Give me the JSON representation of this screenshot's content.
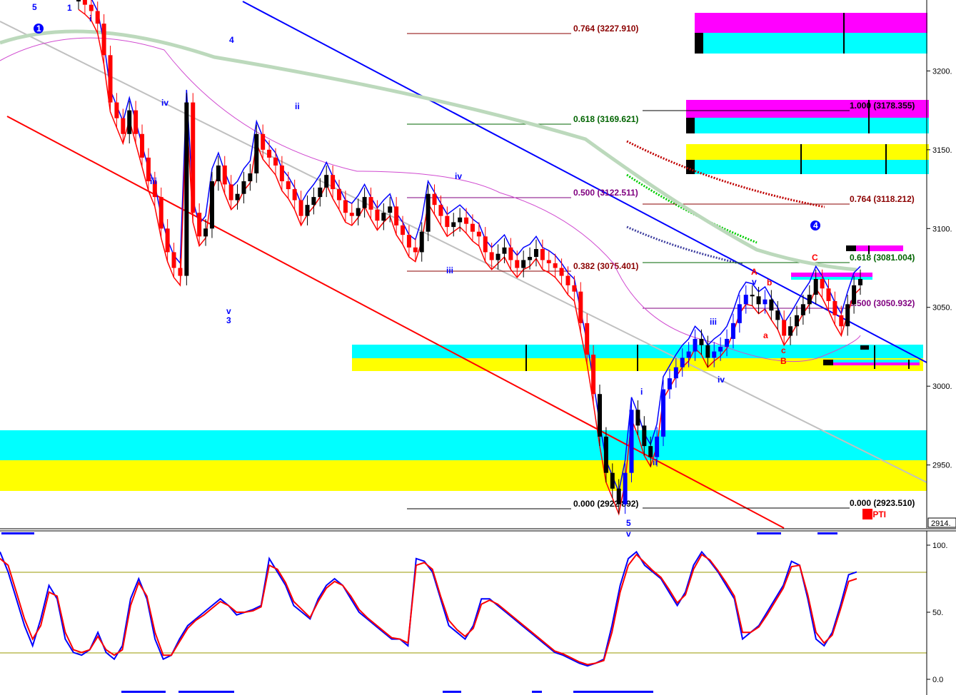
{
  "colors": {
    "cyan": "#00ffff",
    "yellow": "#ffff00",
    "magenta": "#ff00ff",
    "red": "#ff0000",
    "blue": "#0000ff",
    "black": "#000000",
    "dark_red": "#8b0000",
    "green": "#006400",
    "purple": "#800080",
    "pale_green": "#bcd9bc",
    "olive": "#999900"
  },
  "chart_data": [
    {
      "type": "candlestick",
      "title": "",
      "y_axis_ticks": [
        "3200.",
        "3150.",
        "3100.",
        "3050.",
        "3000.",
        "2950."
      ],
      "last_price_label": "2914.",
      "ylim": [
        2910,
        3245
      ],
      "grid": false,
      "price_path": [
        3245,
        3242,
        3238,
        3230,
        3210,
        3180,
        3170,
        3160,
        3175,
        3160,
        3145,
        3130,
        3120,
        3100,
        3085,
        3075,
        3070,
        3180,
        3110,
        3095,
        3100,
        3130,
        3140,
        3128,
        3118,
        3122,
        3130,
        3135,
        3160,
        3150,
        3145,
        3140,
        3130,
        3125,
        3118,
        3108,
        3115,
        3120,
        3126,
        3134,
        3125,
        3118,
        3110,
        3108,
        3113,
        3120,
        3112,
        3105,
        3110,
        3114,
        3102,
        3096,
        3088,
        3085,
        3098,
        3122,
        3115,
        3108,
        3101,
        3104,
        3107,
        3103,
        3098,
        3095,
        3085,
        3080,
        3084,
        3088,
        3080,
        3075,
        3080,
        3082,
        3087,
        3080,
        3078,
        3075,
        3070,
        3064,
        3060,
        3040,
        3020,
        2995,
        2968,
        2945,
        2935,
        2925,
        2945,
        2985,
        2975,
        2962,
        2955,
        2968,
        2998,
        3005,
        3012,
        3018,
        3022,
        3030,
        3026,
        3018,
        3022,
        3025,
        3030,
        3040,
        3052,
        3058,
        3057,
        3052,
        3055,
        3048,
        3042,
        3032,
        3038,
        3045,
        3052,
        3058,
        3068,
        3062,
        3054,
        3045,
        3038,
        3052,
        3064,
        3068
      ],
      "annotations": {
        "wave_labels": [
          "5",
          "1",
          "i",
          "1",
          "iv",
          "iii",
          "v",
          "3",
          "4",
          "ii",
          "iii",
          "iv",
          "v",
          "5",
          "i",
          "ii",
          "iii",
          "iv",
          "A",
          "v",
          "b",
          "a",
          "c",
          "B",
          "C",
          "4"
        ],
        "fib_labels": [
          "0.764 (3227.910)",
          "0.618 (3169.621)",
          "0.500 (3122.511)",
          "0.382 (3075.401)",
          "0.000 (2922.892)",
          "1.000 (3178.355)",
          "0.764 (3118.212)",
          "0.618 (3081.004)",
          "0.500 (3050.932)",
          "0.000 (2923.510)"
        ],
        "indicator_tag": "47PTI"
      },
      "series": [
        {
          "color": "red"
        },
        {
          "color": "blue"
        },
        {
          "color": "purple"
        },
        {
          "color": "pale_green"
        }
      ]
    },
    {
      "type": "line",
      "title": "",
      "y_axis_ticks": [
        "100.",
        "50.",
        "0.0"
      ],
      "ylim": [
        0,
        100
      ],
      "grid": false,
      "series": [
        {
          "color": "blue",
          "values": [
            95,
            80,
            60,
            40,
            25,
            45,
            70,
            60,
            30,
            20,
            18,
            22,
            35,
            20,
            15,
            25,
            60,
            75,
            60,
            30,
            15,
            18,
            30,
            40,
            45,
            50,
            55,
            60,
            55,
            48,
            50,
            52,
            55,
            90,
            80,
            70,
            55,
            50,
            45,
            60,
            70,
            75,
            70,
            60,
            50,
            45,
            40,
            35,
            30,
            30,
            25,
            90,
            88,
            80,
            60,
            40,
            35,
            30,
            40,
            60,
            60,
            55,
            50,
            45,
            40,
            35,
            30,
            25,
            20,
            18,
            15,
            12,
            10,
            12,
            15,
            40,
            70,
            90,
            95,
            85,
            80,
            75,
            65,
            55,
            65,
            85,
            95,
            88,
            80,
            70,
            60,
            30,
            35,
            40,
            50,
            60,
            70,
            88,
            85,
            60,
            30,
            25,
            35,
            55,
            78,
            80
          ]
        },
        {
          "color": "red",
          "values": [
            90,
            85,
            65,
            45,
            30,
            40,
            65,
            62,
            35,
            22,
            20,
            22,
            32,
            22,
            18,
            22,
            55,
            72,
            62,
            35,
            18,
            18,
            28,
            38,
            44,
            48,
            53,
            58,
            55,
            50,
            50,
            51,
            54,
            85,
            82,
            72,
            58,
            52,
            46,
            58,
            68,
            73,
            70,
            62,
            52,
            46,
            41,
            36,
            31,
            30,
            27,
            85,
            87,
            82,
            62,
            44,
            37,
            32,
            38,
            56,
            59,
            56,
            51,
            46,
            41,
            36,
            31,
            26,
            21,
            19,
            16,
            13,
            11,
            12,
            14,
            35,
            65,
            85,
            93,
            87,
            81,
            76,
            67,
            57,
            63,
            82,
            93,
            89,
            81,
            72,
            62,
            35,
            35,
            39,
            48,
            58,
            68,
            84,
            85,
            63,
            35,
            27,
            33,
            52,
            73,
            75
          ]
        }
      ]
    }
  ]
}
